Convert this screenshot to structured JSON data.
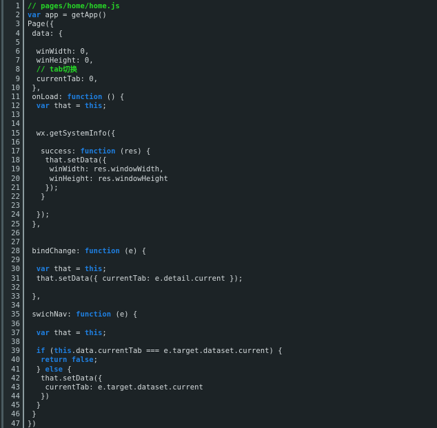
{
  "editor": {
    "file_name": "pages/home/home.js",
    "language": "javascript",
    "total_lines": 47,
    "theme": {
      "background": "#1c2326",
      "gutter_background": "#222a2d",
      "gutter_accent": "#4b5b60",
      "gutter_separator": "#8a9a9e",
      "line_number_color": "#b9c6ca",
      "default_text": "#d4dadc",
      "comment_color": "#27d527",
      "keyword_color": "#1f7fe0"
    },
    "line_numbers": [
      1,
      2,
      3,
      4,
      5,
      6,
      7,
      8,
      9,
      10,
      11,
      12,
      13,
      14,
      15,
      16,
      17,
      18,
      19,
      20,
      21,
      22,
      23,
      24,
      25,
      26,
      27,
      28,
      29,
      30,
      31,
      32,
      33,
      34,
      35,
      36,
      37,
      38,
      39,
      40,
      41,
      42,
      43,
      44,
      45,
      46,
      47
    ],
    "lines": [
      {
        "n": 1,
        "tokens": [
          {
            "t": "// pages/home/home.js",
            "c": "comment"
          }
        ]
      },
      {
        "n": 2,
        "tokens": [
          {
            "t": "var",
            "c": "keyword"
          },
          {
            "t": " app = getApp()",
            "c": "plain"
          }
        ]
      },
      {
        "n": 3,
        "tokens": [
          {
            "t": "Page({",
            "c": "plain"
          }
        ]
      },
      {
        "n": 4,
        "tokens": [
          {
            "t": " data: {",
            "c": "plain"
          }
        ]
      },
      {
        "n": 5,
        "tokens": [
          {
            "t": "",
            "c": "plain"
          }
        ]
      },
      {
        "n": 6,
        "tokens": [
          {
            "t": "  winWidth: 0,",
            "c": "plain"
          }
        ]
      },
      {
        "n": 7,
        "tokens": [
          {
            "t": "  winHeight: 0,",
            "c": "plain"
          }
        ]
      },
      {
        "n": 8,
        "tokens": [
          {
            "t": "  ",
            "c": "plain"
          },
          {
            "t": "// tab切换",
            "c": "comment"
          }
        ]
      },
      {
        "n": 9,
        "tokens": [
          {
            "t": "  currentTab: 0,",
            "c": "plain"
          }
        ]
      },
      {
        "n": 10,
        "tokens": [
          {
            "t": " },",
            "c": "plain"
          }
        ]
      },
      {
        "n": 11,
        "tokens": [
          {
            "t": " onLoad: ",
            "c": "plain"
          },
          {
            "t": "function",
            "c": "keyword"
          },
          {
            "t": " () {",
            "c": "plain"
          }
        ]
      },
      {
        "n": 12,
        "tokens": [
          {
            "t": "  ",
            "c": "plain"
          },
          {
            "t": "var",
            "c": "keyword"
          },
          {
            "t": " that = ",
            "c": "plain"
          },
          {
            "t": "this",
            "c": "keyword"
          },
          {
            "t": ";",
            "c": "plain"
          }
        ]
      },
      {
        "n": 13,
        "tokens": [
          {
            "t": "",
            "c": "plain"
          }
        ]
      },
      {
        "n": 14,
        "tokens": [
          {
            "t": "",
            "c": "plain"
          }
        ]
      },
      {
        "n": 15,
        "tokens": [
          {
            "t": "  wx.getSystemInfo({",
            "c": "plain"
          }
        ]
      },
      {
        "n": 16,
        "tokens": [
          {
            "t": "",
            "c": "plain"
          }
        ]
      },
      {
        "n": 17,
        "tokens": [
          {
            "t": "   success: ",
            "c": "plain"
          },
          {
            "t": "function",
            "c": "keyword"
          },
          {
            "t": " (res) {",
            "c": "plain"
          }
        ]
      },
      {
        "n": 18,
        "tokens": [
          {
            "t": "    that.setData({",
            "c": "plain"
          }
        ]
      },
      {
        "n": 19,
        "tokens": [
          {
            "t": "     winWidth: res.windowWidth,",
            "c": "plain"
          }
        ]
      },
      {
        "n": 20,
        "tokens": [
          {
            "t": "     winHeight: res.windowHeight",
            "c": "plain"
          }
        ]
      },
      {
        "n": 21,
        "tokens": [
          {
            "t": "    });",
            "c": "plain"
          }
        ]
      },
      {
        "n": 22,
        "tokens": [
          {
            "t": "   }",
            "c": "plain"
          }
        ]
      },
      {
        "n": 23,
        "tokens": [
          {
            "t": "",
            "c": "plain"
          }
        ]
      },
      {
        "n": 24,
        "tokens": [
          {
            "t": "  });",
            "c": "plain"
          }
        ]
      },
      {
        "n": 25,
        "tokens": [
          {
            "t": " },",
            "c": "plain"
          }
        ]
      },
      {
        "n": 26,
        "tokens": [
          {
            "t": "",
            "c": "plain"
          }
        ]
      },
      {
        "n": 27,
        "tokens": [
          {
            "t": "",
            "c": "plain"
          }
        ]
      },
      {
        "n": 28,
        "tokens": [
          {
            "t": " bindChange: ",
            "c": "plain"
          },
          {
            "t": "function",
            "c": "keyword"
          },
          {
            "t": " (e) {",
            "c": "plain"
          }
        ]
      },
      {
        "n": 29,
        "tokens": [
          {
            "t": "",
            "c": "plain"
          }
        ]
      },
      {
        "n": 30,
        "tokens": [
          {
            "t": "  ",
            "c": "plain"
          },
          {
            "t": "var",
            "c": "keyword"
          },
          {
            "t": " that = ",
            "c": "plain"
          },
          {
            "t": "this",
            "c": "keyword"
          },
          {
            "t": ";",
            "c": "plain"
          }
        ]
      },
      {
        "n": 31,
        "tokens": [
          {
            "t": "  that.setData({ currentTab: e.detail.current });",
            "c": "plain"
          }
        ]
      },
      {
        "n": 32,
        "tokens": [
          {
            "t": "",
            "c": "plain"
          }
        ]
      },
      {
        "n": 33,
        "tokens": [
          {
            "t": " },",
            "c": "plain"
          }
        ]
      },
      {
        "n": 34,
        "tokens": [
          {
            "t": "",
            "c": "plain"
          }
        ]
      },
      {
        "n": 35,
        "tokens": [
          {
            "t": " swichNav: ",
            "c": "plain"
          },
          {
            "t": "function",
            "c": "keyword"
          },
          {
            "t": " (e) {",
            "c": "plain"
          }
        ]
      },
      {
        "n": 36,
        "tokens": [
          {
            "t": "",
            "c": "plain"
          }
        ]
      },
      {
        "n": 37,
        "tokens": [
          {
            "t": "  ",
            "c": "plain"
          },
          {
            "t": "var",
            "c": "keyword"
          },
          {
            "t": " that = ",
            "c": "plain"
          },
          {
            "t": "this",
            "c": "keyword"
          },
          {
            "t": ";",
            "c": "plain"
          }
        ]
      },
      {
        "n": 38,
        "tokens": [
          {
            "t": "",
            "c": "plain"
          }
        ]
      },
      {
        "n": 39,
        "tokens": [
          {
            "t": "  ",
            "c": "plain"
          },
          {
            "t": "if",
            "c": "keyword"
          },
          {
            "t": " (",
            "c": "plain"
          },
          {
            "t": "this",
            "c": "keyword"
          },
          {
            "t": ".data.currentTab === e.target.dataset.current) {",
            "c": "plain"
          }
        ]
      },
      {
        "n": 40,
        "tokens": [
          {
            "t": "   ",
            "c": "plain"
          },
          {
            "t": "return",
            "c": "keyword"
          },
          {
            "t": " ",
            "c": "plain"
          },
          {
            "t": "false",
            "c": "keyword"
          },
          {
            "t": ";",
            "c": "plain"
          }
        ]
      },
      {
        "n": 41,
        "tokens": [
          {
            "t": "  } ",
            "c": "plain"
          },
          {
            "t": "else",
            "c": "keyword"
          },
          {
            "t": " {",
            "c": "plain"
          }
        ]
      },
      {
        "n": 42,
        "tokens": [
          {
            "t": "   that.setData({",
            "c": "plain"
          }
        ]
      },
      {
        "n": 43,
        "tokens": [
          {
            "t": "    currentTab: e.target.dataset.current",
            "c": "plain"
          }
        ]
      },
      {
        "n": 44,
        "tokens": [
          {
            "t": "   })",
            "c": "plain"
          }
        ]
      },
      {
        "n": 45,
        "tokens": [
          {
            "t": "  }",
            "c": "plain"
          }
        ]
      },
      {
        "n": 46,
        "tokens": [
          {
            "t": " }",
            "c": "plain"
          }
        ]
      },
      {
        "n": 47,
        "tokens": [
          {
            "t": "})",
            "c": "plain"
          }
        ]
      }
    ]
  }
}
